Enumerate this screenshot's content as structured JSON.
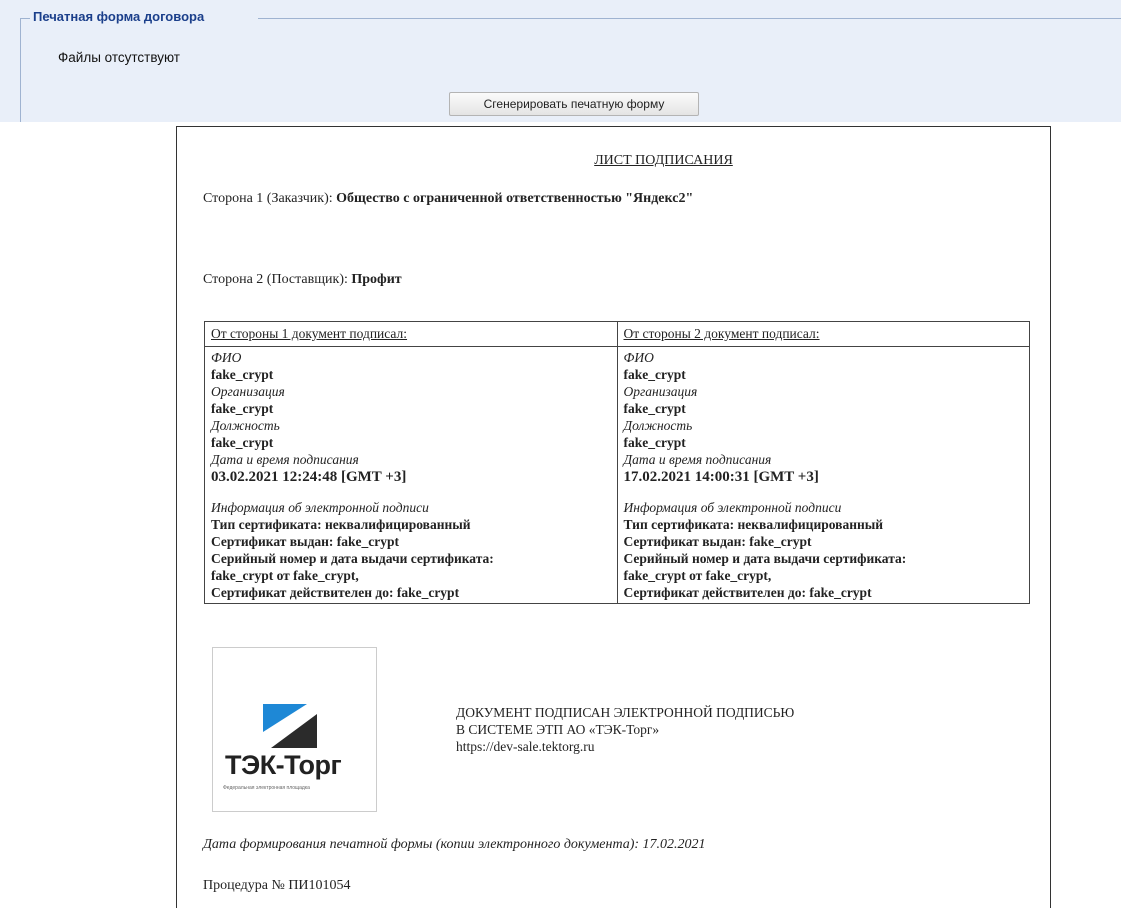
{
  "panel": {
    "legend": "Печатная форма договора",
    "no_files": "Файлы отсутствуют",
    "generate_button": "Сгенерировать печатную форму"
  },
  "document": {
    "title": "ЛИСТ ПОДПИСАНИЯ",
    "party1_label": "Сторона 1 (Заказчик): ",
    "party1_name": "Общество с ограниченной ответственностью \"Яндекс2\"",
    "party2_label": "Сторона 2 (Поставщик): ",
    "party2_name": "Профит",
    "signers": [
      {
        "header": "От стороны 1 документ подписал:",
        "fio_label": "ФИО",
        "fio": "fake_crypt",
        "org_label": "Организация",
        "org": "fake_crypt",
        "position_label": "Должность",
        "position": "fake_crypt",
        "datetime_label": "Дата и время подписания",
        "datetime": "03.02.2021 12:24:48 [GMT +3]",
        "sig_info_label": "Информация об электронной подписи",
        "cert_type": "Тип сертификата: неквалифицированный",
        "cert_issued": "Сертификат выдан: fake_crypt",
        "cert_serial": "Серийный номер и дата выдачи сертификата:",
        "cert_serial_value": "fake_crypt от fake_crypt,",
        "cert_valid": "Сертификат действителен до: fake_crypt"
      },
      {
        "header": "От стороны 2 документ подписал:",
        "fio_label": "ФИО",
        "fio": "fake_crypt",
        "org_label": "Организация",
        "org": "fake_crypt",
        "position_label": "Должность",
        "position": "fake_crypt",
        "datetime_label": "Дата и время подписания",
        "datetime": "17.02.2021 14:00:31 [GMT +3]",
        "sig_info_label": "Информация об электронной подписи",
        "cert_type": "Тип сертификата: неквалифицированный",
        "cert_issued": "Сертификат выдан: fake_crypt",
        "cert_serial": "Серийный номер и дата выдачи сертификата:",
        "cert_serial_value": "fake_crypt от fake_crypt,",
        "cert_valid": "Сертификат действителен до: fake_crypt"
      }
    ],
    "stamp": {
      "brand": "ТЭК-Торг",
      "tagline": "Федеральная электронная площадка",
      "logo_colors": {
        "blue": "#1e88d6",
        "dark": "#2b2b2b"
      }
    },
    "signed_lines": [
      "ДОКУМЕНТ ПОДПИСАН ЭЛЕКТРОННОЙ ПОДПИСЬЮ",
      "В СИСТЕМЕ ЭТП АО «ТЭК-Торг»",
      "https://dev-sale.tektorg.ru"
    ],
    "print_date": "Дата формирования печатной формы (копии электронного документа): 17.02.2021",
    "procedure": "Процедура № ПИ101054"
  }
}
